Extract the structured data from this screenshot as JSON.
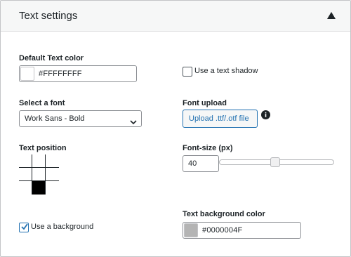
{
  "panel": {
    "title": "Text settings"
  },
  "text_color": {
    "label": "Default Text color",
    "value": "#FFFFFFFF",
    "swatch_color": "#ffffff"
  },
  "text_shadow": {
    "label": "Use a text shadow",
    "checked": false
  },
  "font": {
    "label": "Select a font",
    "selected": "Work Sans - Bold"
  },
  "font_upload": {
    "label": "Font upload",
    "button_label": "Upload .ttf/.otf file",
    "info_icon": "info-icon"
  },
  "text_position": {
    "label": "Text position",
    "selected_row": 2,
    "selected_col": 1
  },
  "font_size": {
    "label": "Font-size (px)",
    "value": "40",
    "slider_fraction": 0.49
  },
  "background": {
    "label": "Use a background",
    "checked": true
  },
  "bg_color": {
    "label": "Text background color",
    "value": "#0000004F",
    "swatch_color": "#b4b4b4"
  },
  "colors": {
    "accent": "#2271b1",
    "border": "#8c8f94",
    "header_bg": "#f6f7f7"
  }
}
